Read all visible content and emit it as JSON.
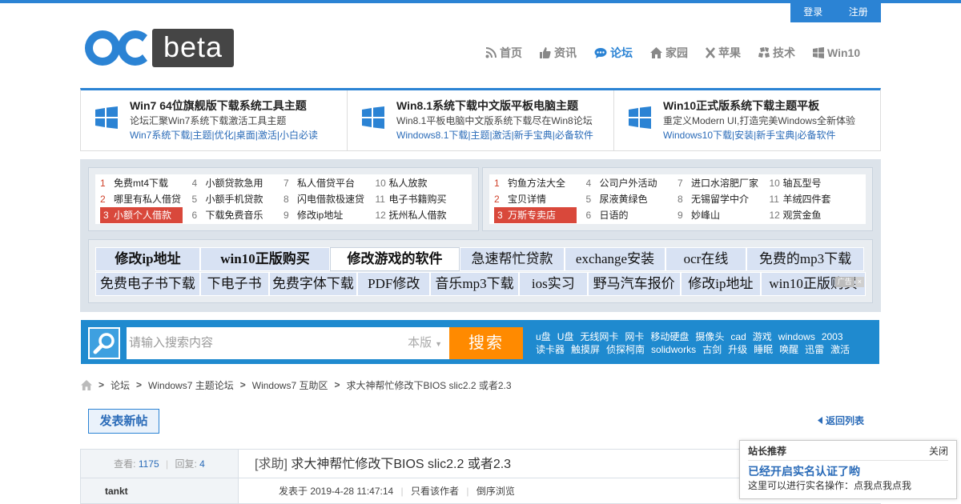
{
  "login_bar": {
    "login": "登录",
    "register": "注册"
  },
  "logo": {
    "text": "beta"
  },
  "nav": [
    {
      "label": "首页",
      "icon": "rss-icon"
    },
    {
      "label": "资讯",
      "icon": "thumbs-up-icon"
    },
    {
      "label": "论坛",
      "icon": "chat-bubble-icon",
      "active": true
    },
    {
      "label": "家园",
      "icon": "home-icon"
    },
    {
      "label": "苹果",
      "icon": "x-icon"
    },
    {
      "label": "技术",
      "icon": "puzzle-icon"
    },
    {
      "label": "Win10",
      "icon": "windows-icon"
    }
  ],
  "featured": [
    {
      "title": "Win7 64位旗舰版下载系统工具主题",
      "subtitle": "论坛汇聚Win7系统下载激活工具主题",
      "links": [
        "Win7系统下载",
        "主题",
        "优化",
        "桌面",
        "激活",
        "小白必读"
      ]
    },
    {
      "title": "Win8.1系统下载中文版平板电脑主题",
      "subtitle": "Win8.1平板电脑中文版系统下载尽在Win8论坛",
      "links": [
        "Windows8.1下载",
        "主题",
        "激活",
        "新手宝典",
        "必备软件"
      ]
    },
    {
      "title": "Win10正式版系统下载主题平板",
      "subtitle": "重定义Modern UI,打造完美Windows全新体验",
      "links": [
        "Windows10下载",
        "安装",
        "新手宝典",
        "必备软件"
      ]
    }
  ],
  "rank_left": [
    {
      "num": "1",
      "text": "免费mt4下载"
    },
    {
      "num": "4",
      "text": "小额贷款急用"
    },
    {
      "num": "7",
      "text": "私人借贷平台"
    },
    {
      "num": "10",
      "text": "私人放款"
    },
    {
      "num": "2",
      "text": "哪里有私人借贷"
    },
    {
      "num": "5",
      "text": "小额手机贷款"
    },
    {
      "num": "8",
      "text": "闪电借款极速贷"
    },
    {
      "num": "11",
      "text": "电子书籍购买"
    },
    {
      "num": "3",
      "text": "小额个人借款"
    },
    {
      "num": "6",
      "text": "下载免费音乐"
    },
    {
      "num": "9",
      "text": "修改ip地址"
    },
    {
      "num": "12",
      "text": "抚州私人借款"
    }
  ],
  "rank_right": [
    {
      "num": "1",
      "text": "钓鱼方法大全"
    },
    {
      "num": "4",
      "text": "公司户外活动"
    },
    {
      "num": "7",
      "text": "进口水溶肥厂家"
    },
    {
      "num": "10",
      "text": "轴瓦型号"
    },
    {
      "num": "2",
      "text": "宝贝详情"
    },
    {
      "num": "5",
      "text": "尿液黄绿色"
    },
    {
      "num": "8",
      "text": "无锡留学中介"
    },
    {
      "num": "11",
      "text": "羊绒四件套"
    },
    {
      "num": "3",
      "text": "万斯专卖店"
    },
    {
      "num": "6",
      "text": "日语的"
    },
    {
      "num": "9",
      "text": "妙峰山"
    },
    {
      "num": "12",
      "text": "观赏金鱼"
    }
  ],
  "tags_row1": [
    {
      "text": "修改ip地址",
      "w": 131,
      "bold": true
    },
    {
      "text": "win10正版购买",
      "w": 162,
      "bold": true
    },
    {
      "text": "修改游戏的软件",
      "w": 162,
      "bold": true,
      "white": true
    },
    {
      "text": "急速帮忙贷款",
      "w": 131
    },
    {
      "text": "exchange安装",
      "w": 126
    },
    {
      "text": "ocr在线",
      "w": 101
    },
    {
      "text": "免费的mp3下载",
      "w": 147
    }
  ],
  "tags_row2": [
    {
      "text": "免费电子书下载",
      "w": 131
    },
    {
      "text": "下电子书",
      "w": 86
    },
    {
      "text": "免费字体下载",
      "w": 111
    },
    {
      "text": "PDF修改",
      "w": 91
    },
    {
      "text": "音乐mp3下载",
      "w": 111
    },
    {
      "text": "ios实习",
      "w": 86
    },
    {
      "text": "野马汽车报价",
      "w": 116
    },
    {
      "text": "修改ip地址",
      "w": 101
    },
    {
      "text": "win10正版购买",
      "w": 131
    }
  ],
  "ad_mark": {
    "label": "广告",
    "close": "×"
  },
  "search": {
    "placeholder": "请输入搜索内容",
    "scope": "本版",
    "button": "搜索",
    "hotwords_row1": [
      "u盘",
      "U盘",
      "无线网卡",
      "网卡",
      "移动硬盘",
      "摄像头",
      "cad",
      "游戏",
      "windows",
      "2003"
    ],
    "hotwords_row2": [
      "读卡器",
      "触摸屏",
      "侦探柯南",
      "solidworks",
      "古剑",
      "升级",
      "睡眠",
      "唤醒",
      "迅雷",
      "激活"
    ]
  },
  "breadcrumb": [
    "论坛",
    "Windows7 主题论坛",
    "Windows7 互助区",
    "求大神帮忙修改下BIOS slic2.2 或者2.3"
  ],
  "actions": {
    "new_post": "发表新帖",
    "back_list": "返回列表"
  },
  "thread": {
    "views_label": "查看:",
    "views": "1175",
    "replies_label": "回复:",
    "replies": "4",
    "author": "tankt",
    "title_tag": "[求助]",
    "title": "求大神帮忙修改下BIOS slic2.2 或者2.3",
    "post_time": "发表于 2019-4-28 11:47:14",
    "only_author": "只看该作者",
    "reverse": "倒序浏览"
  },
  "popup": {
    "header": "站长推荐",
    "close": "关闭",
    "title": "已经开启实名认证了哟",
    "text": "这里可以进行实名操作：点我点我点我"
  },
  "colors": {
    "brand_blue": "#2b83d4",
    "search_band": "#1f8acf",
    "search_button": "#ff8a00",
    "hot_rank": "#d9483b"
  }
}
